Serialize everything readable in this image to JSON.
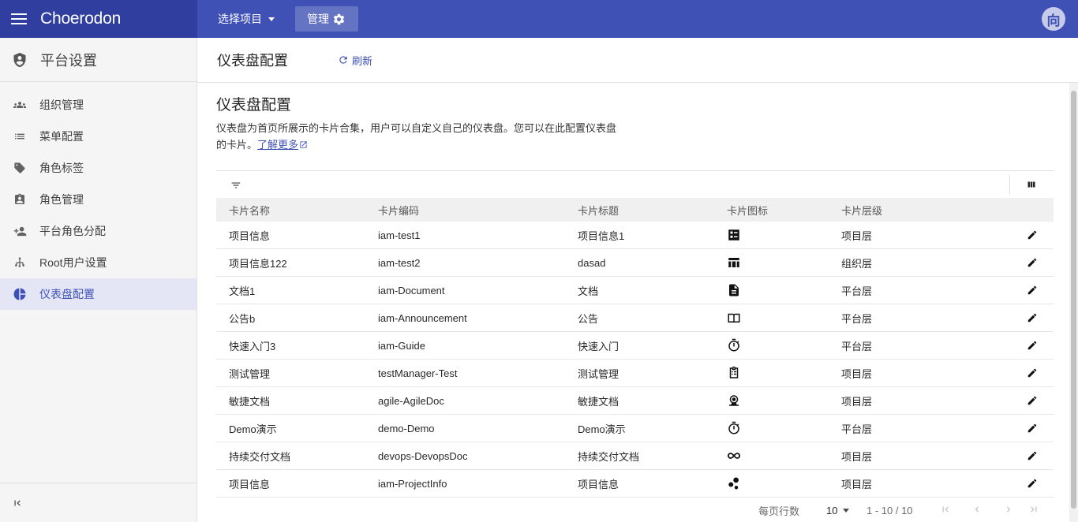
{
  "header": {
    "brand": "Choerodon",
    "project_select": "选择项目",
    "manage": "管理",
    "avatar": "向"
  },
  "sidebar": {
    "title": "平台设置",
    "items": [
      {
        "label": "组织管理",
        "icon": "group-icon"
      },
      {
        "label": "菜单配置",
        "icon": "list-icon"
      },
      {
        "label": "角色标签",
        "icon": "tag-icon"
      },
      {
        "label": "角色管理",
        "icon": "badge-icon"
      },
      {
        "label": "平台角色分配",
        "icon": "person-add-icon"
      },
      {
        "label": "Root用户设置",
        "icon": "root-icon"
      },
      {
        "label": "仪表盘配置",
        "icon": "dashboard-icon",
        "active": true
      }
    ]
  },
  "page": {
    "header_title": "仪表盘配置",
    "refresh": "刷新",
    "title": "仪表盘配置",
    "desc_line1": "仪表盘为首页所展示的卡片合集，用户可以自定义自己的仪表盘。您可以在此配置仪表盘",
    "desc_line2": "的卡片。",
    "learn_more": "了解更多"
  },
  "table": {
    "columns": [
      "卡片名称",
      "卡片编码",
      "卡片标题",
      "卡片图标",
      "卡片层级"
    ],
    "rows": [
      {
        "name": "项目信息",
        "code": "iam-test1",
        "title": "项目信息1",
        "icon": "dashboard-widget-icon",
        "level": "项目层"
      },
      {
        "name": "项目信息122",
        "code": "iam-test2",
        "title": "dasad",
        "icon": "table-icon",
        "level": "组织层"
      },
      {
        "name": "文档1",
        "code": "iam-Document",
        "title": "文档",
        "icon": "document-icon",
        "level": "平台层"
      },
      {
        "name": "公告b",
        "code": "iam-Announcement",
        "title": "公告",
        "icon": "book-icon",
        "level": "平台层"
      },
      {
        "name": "快速入门3",
        "code": "iam-Guide",
        "title": "快速入门",
        "icon": "timer-icon",
        "level": "平台层"
      },
      {
        "name": "测试管理",
        "code": "testManager-Test",
        "title": "测试管理",
        "icon": "clipboard-icon",
        "level": "项目层"
      },
      {
        "name": "敏捷文档",
        "code": "agile-AgileDoc",
        "title": "敏捷文档",
        "icon": "webcam-icon",
        "level": "项目层"
      },
      {
        "name": "Demo演示",
        "code": "demo-Demo",
        "title": "Demo演示",
        "icon": "timer-icon",
        "level": "平台层"
      },
      {
        "name": "持续交付文档",
        "code": "devops-DevopsDoc",
        "title": "持续交付文档",
        "icon": "infinity-icon",
        "level": "项目层"
      },
      {
        "name": "项目信息",
        "code": "iam-ProjectInfo",
        "title": "项目信息",
        "icon": "bubbles-icon",
        "level": "项目层"
      }
    ]
  },
  "pager": {
    "per_page_label": "每页行数",
    "per_page": "10",
    "range": "1 - 10 / 10"
  },
  "colors": {
    "primary": "#3f51b5",
    "primary_dark": "#303f9f"
  }
}
